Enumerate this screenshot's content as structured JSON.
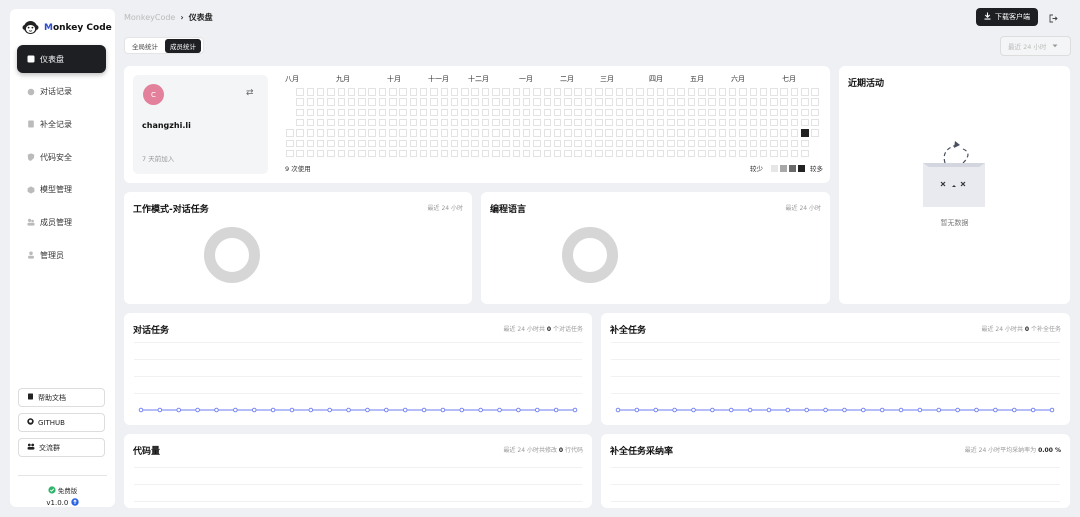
{
  "sidebar": {
    "brand": {
      "first": "M",
      "rest": "onkey Code"
    },
    "items": [
      {
        "label": "仪表盘",
        "icon": "dashboard-icon",
        "active": true
      },
      {
        "label": "对话记录",
        "icon": "chat-icon",
        "active": false
      },
      {
        "label": "补全记录",
        "icon": "document-icon",
        "active": false
      },
      {
        "label": "代码安全",
        "icon": "shield-icon",
        "active": false
      },
      {
        "label": "模型管理",
        "icon": "cube-icon",
        "active": false
      },
      {
        "label": "成员管理",
        "icon": "users-icon",
        "active": false
      },
      {
        "label": "管理员",
        "icon": "user-icon",
        "active": false
      }
    ],
    "links": [
      {
        "label": "帮助文档",
        "icon": "book-icon"
      },
      {
        "label": "GITHUB",
        "icon": "github-icon"
      },
      {
        "label": "交流群",
        "icon": "group-icon"
      }
    ],
    "edition": "免费版",
    "version": "v1.0.0"
  },
  "header": {
    "breadcrumb_root": "MonkeyCode",
    "breadcrumb_current": "仪表盘",
    "download_label": "下载客户端",
    "time_range": "最近 24 小时"
  },
  "tabs": [
    {
      "label": "全局统计",
      "active": false
    },
    {
      "label": "成员统计",
      "active": true
    }
  ],
  "member": {
    "avatar_letter": "C",
    "username": "changzhi.li",
    "joined": "7 天前加入",
    "usage": "9 次使用",
    "months": [
      "八月",
      "九月",
      "十月",
      "十一月",
      "十二月",
      "一月",
      "二月",
      "三月",
      "四月",
      "五月",
      "六月",
      "七月"
    ],
    "legend_less": "较少",
    "legend_more": "较多",
    "legend_colors": [
      "#e6e6e6",
      "#a8a8a8",
      "#6a6a6a",
      "#222222"
    ]
  },
  "cards": {
    "work_mode": {
      "title": "工作模式-对话任务",
      "meta": "最近 24 小时"
    },
    "languages": {
      "title": "编程语言",
      "meta": "最近 24 小时"
    },
    "recent": {
      "title": "近期活动",
      "empty": "暂无数据"
    },
    "chat_tasks": {
      "title": "对话任务",
      "meta_prefix": "最近 24 小时共",
      "count": "0",
      "meta_suffix": "个对话任务"
    },
    "completion_tasks": {
      "title": "补全任务",
      "meta_prefix": "最近 24 小时共",
      "count": "0",
      "meta_suffix": "个补全任务"
    },
    "code_volume": {
      "title": "代码量",
      "meta_prefix": "最近 24 小时共修改",
      "count": "0",
      "meta_suffix": "行代码"
    },
    "acceptance": {
      "title": "补全任务采纳率",
      "meta_prefix": "最近 24 小时平均采纳率为",
      "value": "0.00 %"
    }
  },
  "colors": {
    "accent": "#1d1f23",
    "line": "#6b7cf0",
    "brand": "#2b4bd1"
  }
}
